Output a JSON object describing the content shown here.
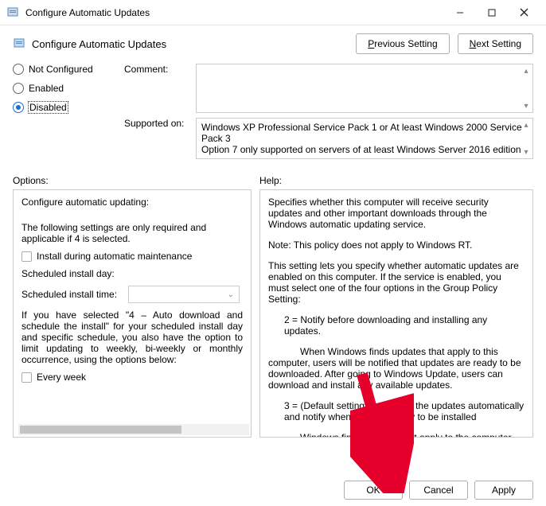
{
  "window": {
    "title": "Configure Automatic Updates"
  },
  "header": {
    "title": "Configure Automatic Updates",
    "prev_label_pre": "P",
    "prev_label_post": "revious Setting",
    "next_label_pre": "N",
    "next_label_post": "ext Setting"
  },
  "radios": {
    "not_configured": "Not Configured",
    "enabled": "Enabled",
    "disabled": "Disabled",
    "selected": "disabled"
  },
  "meta": {
    "comment_label": "Comment:",
    "supported_label": "Supported on:",
    "supported_text": "Windows XP Professional Service Pack 1 or At least Windows 2000 Service Pack 3\nOption 7 only supported on servers of at least Windows Server 2016 edition"
  },
  "sections": {
    "options": "Options:",
    "help": "Help:"
  },
  "options": {
    "heading": "Configure automatic updating:",
    "req_text": "The following settings are only required and applicable if 4 is selected.",
    "chk_maintenance": "Install during automatic maintenance",
    "day_label": "Scheduled install day:",
    "time_label": "Scheduled install time:",
    "paragraph": "If you have selected \"4 – Auto download and schedule the install\" for your scheduled install day and specific schedule, you also have the option to limit updating to weekly, bi-weekly or monthly occurrence, using the options below:",
    "chk_every_week": "Every week"
  },
  "help": {
    "p1": "Specifies whether this computer will receive security updates and other important downloads through the Windows automatic updating service.",
    "p2": "Note: This policy does not apply to Windows RT.",
    "p3": "This setting lets you specify whether automatic updates are enabled on this computer. If the service is enabled, you must select one of the four options in the Group Policy Setting:",
    "p4": "2 = Notify before downloading and installing any updates.",
    "p5": "When Windows finds updates that apply to this computer, users will be notified that updates are ready to be downloaded. After going to Windows Update, users can download and install any available updates.",
    "p6": "3 =  (Default setting) Download the updates automatically and notify when they are ready to be installed",
    "p7": "Windows finds updates that apply to the computer and"
  },
  "footer": {
    "ok": "OK",
    "cancel": "Cancel",
    "apply": "Apply"
  }
}
